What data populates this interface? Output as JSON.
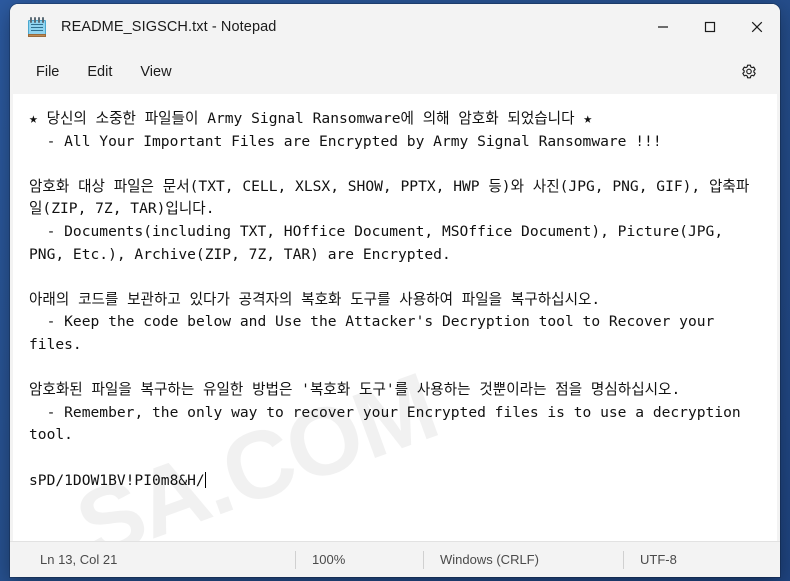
{
  "window": {
    "title": "README_SIGSCH.txt - Notepad",
    "app_icon": "notepad-icon",
    "controls": {
      "minimize": "minimize-icon",
      "maximize": "maximize-icon",
      "close": "close-icon"
    }
  },
  "menubar": {
    "items": [
      {
        "label": "File"
      },
      {
        "label": "Edit"
      },
      {
        "label": "View"
      }
    ],
    "settings_icon": "gear-icon"
  },
  "editor": {
    "watermark": "SA.COM",
    "lines": [
      "★ 당신의 소중한 파일들이 Army Signal Ransomware에 의해 암호화 되었습니다 ★",
      "  - All Your Important Files are Encrypted by Army Signal Ransomware !!!",
      "",
      "암호화 대상 파일은 문서(TXT, CELL, XLSX, SHOW, PPTX, HWP 등)와 사진(JPG, PNG, GIF), 압축파일(ZIP, 7Z, TAR)입니다.",
      "  - Documents(including TXT, HOffice Document, MSOffice Document), Picture(JPG, PNG, Etc.), Archive(ZIP, 7Z, TAR) are Encrypted.",
      "",
      "아래의 코드를 보관하고 있다가 공격자의 복호화 도구를 사용하여 파일을 복구하십시오.",
      "  - Keep the code below and Use the Attacker's Decryption tool to Recover your files.",
      "",
      "암호화된 파일을 복구하는 유일한 방법은 '복호화 도구'를 사용하는 것뿐이라는 점을 명심하십시오.",
      "  - Remember, the only way to recover your Encrypted files is to use a decryption tool.",
      "",
      "sPD/1DOW1BV!PI0m8&H/"
    ]
  },
  "statusbar": {
    "cursor_position": "Ln 13, Col 21",
    "zoom": "100%",
    "line_ending": "Windows (CRLF)",
    "encoding": "UTF-8"
  },
  "colors": {
    "desktop": "#2c5aa0",
    "window_chrome": "#f3f3f3",
    "editor_background": "#ffffff",
    "text": "#111111",
    "status_text": "#4a4a4a",
    "close_hover": "#c42b1c"
  }
}
